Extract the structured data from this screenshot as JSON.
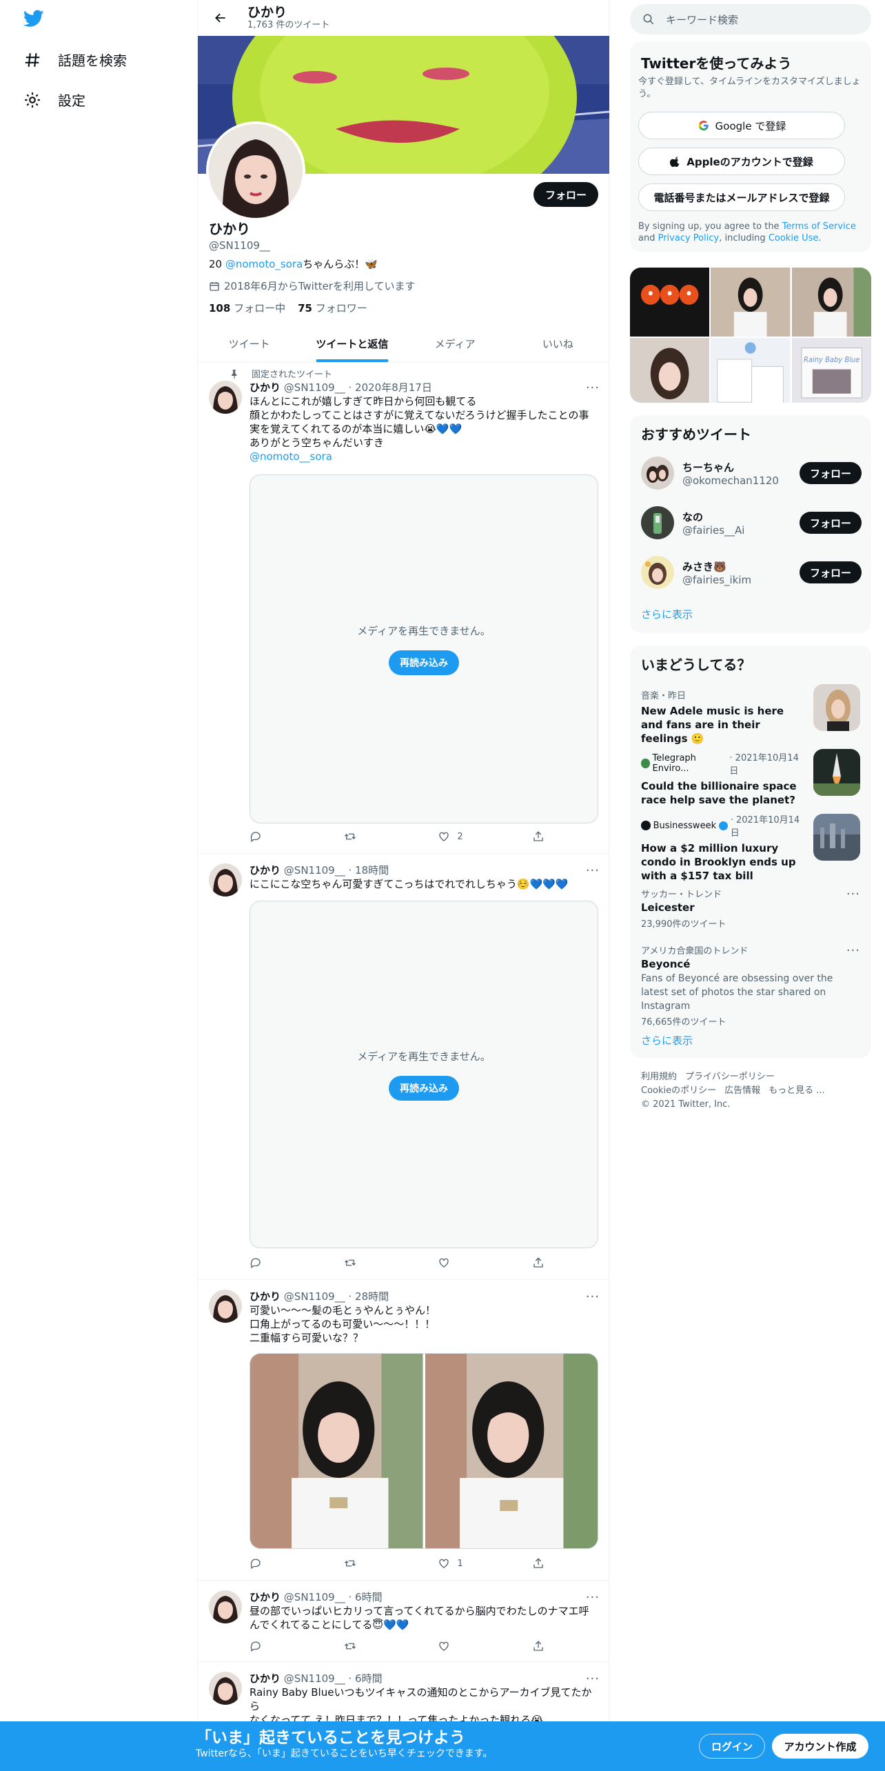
{
  "nav": {
    "explore_label": "話題を検索",
    "settings_label": "設定"
  },
  "header": {
    "name": "ひかり",
    "tweet_count": "1,763 件のツイート"
  },
  "profile": {
    "name": "ひかり",
    "handle": "@SN1109__",
    "bio_prefix": "20 ",
    "bio_mention": "@nomoto_sora",
    "bio_suffix": "ちゃんらぶ！🦋",
    "joined": "2018年6月からTwitterを利用しています",
    "following_count": "108",
    "following_label": "フォロー中",
    "followers_count": "75",
    "followers_label": "フォロワー",
    "follow_button": "フォロー"
  },
  "tabs": [
    "ツイート",
    "ツイートと返信",
    "メディア",
    "いいね"
  ],
  "tweets": [
    {
      "pinned_label": "固定されたツイート",
      "name": "ひかり",
      "handle": "@SN1109__",
      "time": "· 2020年8月17日",
      "lines": [
        "ほんとにこれが嬉しすぎて昨日から何回も観てる",
        "顔とかわたしってことはさすがに覚えてないだろうけど握手したことの事",
        "実を覚えてくれてるのが本当に嬉しい😭💙💙",
        "ありがとう空ちゃんだいすき"
      ],
      "mention": "@nomoto__sora",
      "media_msg": "メディアを再生できません。",
      "reload": "再読み込み",
      "likes": "2"
    },
    {
      "name": "ひかり",
      "handle": "@SN1109__",
      "time": "· 18時間",
      "lines": [
        "にこにこな空ちゃん可愛すぎてこっちはでれでれしちゃう☺️💙💙💙"
      ],
      "media_msg": "メディアを再生できません。",
      "reload": "再読み込み",
      "likes": ""
    },
    {
      "name": "ひかり",
      "handle": "@SN1109__",
      "time": "· 28時間",
      "lines": [
        "可愛い〜〜〜髪の毛とぅやんとぅやん！",
        "口角上がってるのも可愛い〜〜〜！！！",
        "二重幅すら可愛いな？？"
      ],
      "likes": "1"
    },
    {
      "name": "ひかり",
      "handle": "@SN1109__",
      "time": "· 6時間",
      "lines": [
        "昼の部でいっぱいヒカリって言ってくれてるから脳内でわたしのナマエ呼",
        "んでくれてることにしてる😇💙💙"
      ],
      "likes": ""
    },
    {
      "name": "ひかり",
      "handle": "@SN1109__",
      "time": "· 6時間",
      "lines": [
        "Rainy Baby Blueいつもツイキャスの通知のとこからアーカイブ見てたから",
        "なくなってて え！昨日まで？！！って焦ったよかった観れる😭"
      ]
    }
  ],
  "search": {
    "placeholder": "キーワード検索"
  },
  "signup": {
    "title": "Twitterを使ってみよう",
    "subtitle": "今すぐ登録して、タイムラインをカスタマイズしましょう。",
    "google": "Google で登録",
    "apple": "Appleのアカウントで登録",
    "phone": "電話番号またはメールアドレスで登録",
    "terms_prefix": "By signing up, you agree to the ",
    "terms_link": "Terms of Service",
    "terms_and": " and ",
    "privacy_link": "Privacy Policy",
    "terms_mid": ", including ",
    "cookie_link": "Cookie Use",
    "terms_end": "."
  },
  "recommended": {
    "title": "おすすめツイート",
    "users": [
      {
        "name": "ちーちゃん",
        "handle": "@okomechan1120",
        "button": "フォロー"
      },
      {
        "name": "なの",
        "handle": "@fairies__Ai",
        "button": "フォロー"
      },
      {
        "name": "みさき🐻",
        "handle": "@fairies_ikim",
        "button": "フォロー"
      }
    ],
    "more": "さらに表示"
  },
  "trends": {
    "title": "いまどうしてる？",
    "items": [
      {
        "meta": "音楽・昨日",
        "text": "New Adele music is here and fans are in their feelings 🙂"
      },
      {
        "source": "Telegraph Enviro...",
        "meta": "· 2021年10月14日",
        "text": "Could the billionaire space race help save the planet?"
      },
      {
        "source": "Businessweek",
        "meta": "· 2021年10月14日",
        "text": "How a $2 million luxury condo in Brooklyn ends up with a $157 tax bill"
      },
      {
        "meta": "サッカー・トレンド",
        "name": "Leicester",
        "count": "23,990件のツイート"
      },
      {
        "meta": "アメリカ合衆国のトレンド",
        "name": "Beyoncé",
        "desc": "Fans of Beyoncé are obsessing over the latest set of photos the star shared on Instagram",
        "count": "76,665件のツイート"
      }
    ],
    "more": "さらに表示"
  },
  "footer": {
    "terms": "利用規約",
    "privacy": "プライバシーポリシー",
    "cookie": "Cookieのポリシー",
    "ads": "広告情報",
    "more": "もっと見る ...",
    "copyright": "© 2021 Twitter, Inc."
  },
  "bottom_bar": {
    "headline": "「いま」起きていることを見つけよう",
    "sub": "Twitterなら、「いま」起きていることをいち早くチェックできます。",
    "login": "ログイン",
    "signup": "アカウント作成"
  },
  "colors": {
    "accent": "#1d9bf0",
    "text": "#0f1419",
    "muted": "#536471"
  }
}
